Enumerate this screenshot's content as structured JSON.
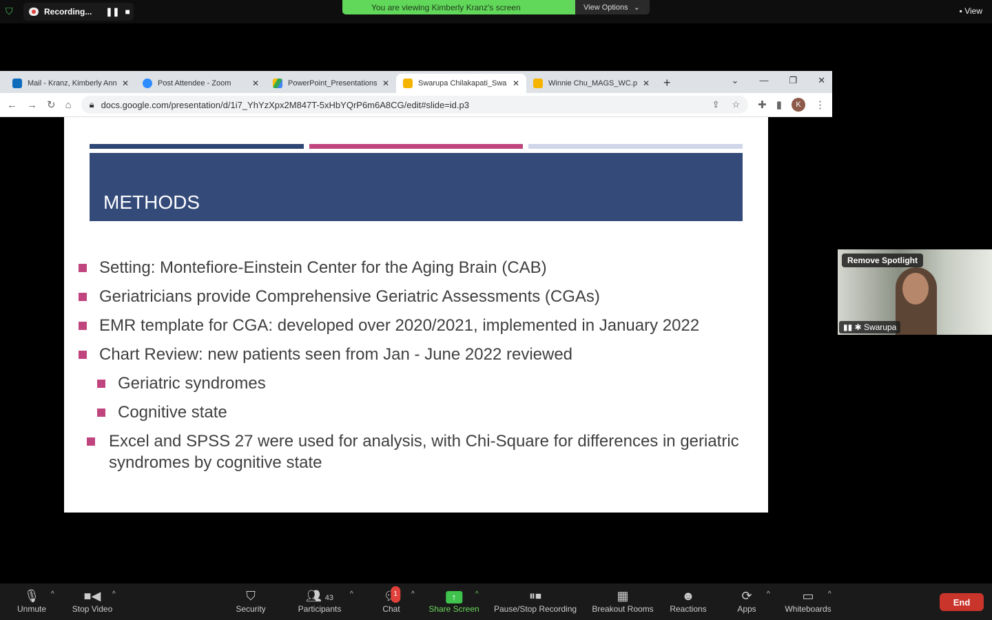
{
  "zoom": {
    "recording_label": "Recording...",
    "viewing_banner": "You are viewing Kimberly Kranz's screen",
    "view_options": "View Options",
    "view": "View"
  },
  "browser": {
    "tabs": [
      {
        "title": "Mail - Kranz, Kimberly Ann",
        "color": "#0f6cbd"
      },
      {
        "title": "Post Attendee - Zoom",
        "color": "#2d8cff"
      },
      {
        "title": "PowerPoint_Presentations",
        "color": "#34a853"
      },
      {
        "title": "Swarupa Chilakapati_Swarupa",
        "color": "#f4b400"
      },
      {
        "title": "Winnie Chu_MAGS_WC.pptx",
        "color": "#f4b400"
      }
    ],
    "url": "docs.google.com/presentation/d/1i7_YhYzXpx2M847T-5xHbYQrP6m6A8CG/edit#slide=id.p3",
    "profile_initial": "K"
  },
  "slide": {
    "title": "METHODS",
    "colors": {
      "navy": "#2e4674",
      "pink": "#c0457f",
      "light": "#d0d6ea",
      "header": "#344b7a"
    },
    "bullets": [
      "Setting: Montefiore-Einstein Center for the Aging Brain (CAB)",
      "Geriatricians provide Comprehensive Geriatric Assessments (CGAs)",
      "EMR template for CGA: developed over 2020/2021, implemented in January 2022",
      "Chart Review: new patients seen from Jan - June 2022 reviewed"
    ],
    "sub_bullets": [
      "Geriatric syndromes",
      "Cognitive state"
    ],
    "last_bullet_line1": "Excel and SPSS 27 were used for analysis, with Chi-Square for differences in geriatric",
    "last_bullet_line2": "syndromes by cognitive state"
  },
  "video": {
    "spotlight": "Remove Spotlight",
    "name": "Swarupa"
  },
  "toolbar": {
    "unmute": "Unmute",
    "stop_video": "Stop Video",
    "security": "Security",
    "participants": "Participants",
    "participants_count": "43",
    "chat": "Chat",
    "chat_badge": "1",
    "share_screen": "Share Screen",
    "pause_stop": "Pause/Stop Recording",
    "breakout": "Breakout Rooms",
    "reactions": "Reactions",
    "apps": "Apps",
    "whiteboards": "Whiteboards",
    "end": "End"
  }
}
